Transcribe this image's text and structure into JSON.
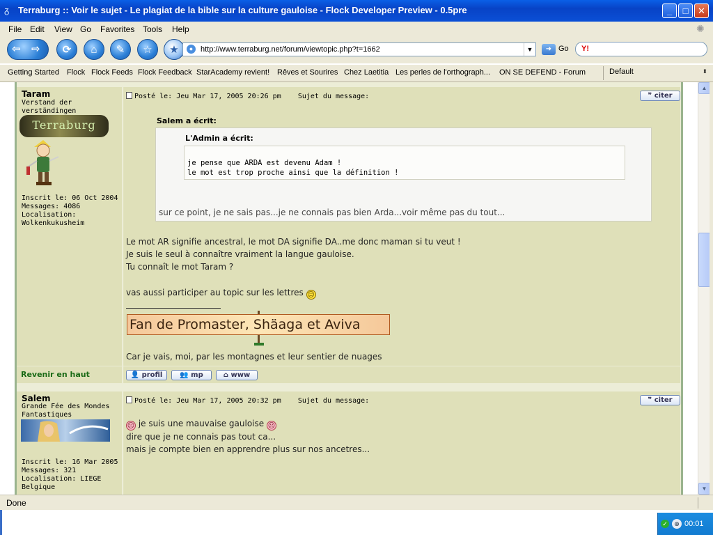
{
  "window": {
    "title": "Terraburg :: Voir le sujet - Le plagiat de la bible sur la culture gauloise - Flock Developer Preview - 0.5pre",
    "minimize_glyph": "_",
    "maximize_glyph": "□",
    "close_glyph": "✕"
  },
  "menu": [
    "File",
    "Edit",
    "View",
    "Go",
    "Favorites",
    "Tools",
    "Help"
  ],
  "nav": {
    "url": "http://www.terraburg.net/forum/viewtopic.php?t=1662",
    "go_label": "Go",
    "search_engine": "Y!",
    "search_placeholder": ""
  },
  "bookmarks": {
    "items": [
      "Getting Started",
      "Flock",
      "Flock Feeds",
      "Flock Feedback",
      "StarAcademy revient!",
      "Rêves et Sourires",
      "Chez Laetitia",
      "Les perles de l'orthograph...",
      "ON SE DEFEND - Forum"
    ],
    "profile": "Default"
  },
  "posts": [
    {
      "author": "Taram",
      "rank": [
        "Verstand der",
        "verständingen"
      ],
      "banner_text": "Terraburg",
      "joined": "Inscrit le: 06 Oct 2004",
      "messages": "Messages: 4086",
      "location_label": "Localisation:",
      "location": "Wolkenkukusheim",
      "posted": "Posté le: Jeu Mar 17, 2005 20:26 pm",
      "subject": "Sujet du message:",
      "quote_button": "citer",
      "quote_author": "Salem a écrit:",
      "nested_quote_author": "L'Admin a écrit:",
      "nested_quote_lines": [
        "je pense que ARDA est devenu Adam !",
        "le mot est trop proche ainsi que la définition !"
      ],
      "quote_reply": "sur ce point, je ne sais pas...je ne connais pas bien Arda...voir même pas du tout...",
      "body_lines": [
        "Le mot AR signifie ancestral, le mot DA signifie DA..me donc maman si tu veut !",
        "Je suis le seul à connaître vraiment la langue gauloise.",
        "Tu connaît le mot Taram ?"
      ],
      "topic_line": "vas aussi participer au topic sur les lettres",
      "signature_banner": "Fan de Promaster, Shäaga et Aviva",
      "signature_line": "Car je vais, moi, par les montagnes et leur sentier de nuages",
      "back_to_top": "Revenir en haut",
      "actions": [
        "profil",
        "mp",
        "www"
      ]
    },
    {
      "author": "Salem",
      "rank": [
        "Grande Fée des Mondes",
        "Fantastiques"
      ],
      "joined": "Inscrit le: 16 Mar 2005",
      "messages": "Messages: 321",
      "location_label": "Localisation: LIEGE",
      "location": "Belgique",
      "posted": "Posté le: Jeu Mar 17, 2005 20:32 pm",
      "subject": "Sujet du message:",
      "quote_button": "citer",
      "body_first": "je suis une mauvaise gauloise",
      "body_lines": [
        "dire que je ne connais pas tout ca...",
        "mais je compte bien en apprendre plus sur nos ancetres..."
      ]
    }
  ],
  "status": "Done",
  "clock": "00:01"
}
